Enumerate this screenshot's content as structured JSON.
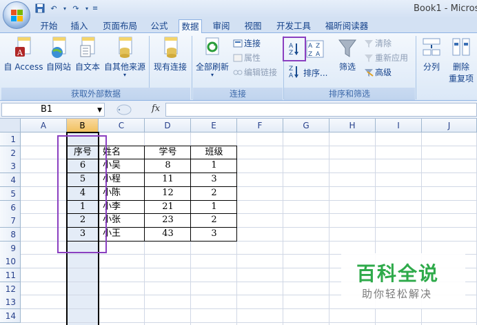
{
  "window": {
    "title": "Book1 - Micros"
  },
  "qat": {
    "save_icon": "save-icon",
    "undo_icon": "undo-icon",
    "redo_icon": "redo-icon",
    "customize_icon": "customize-icon"
  },
  "tabs": [
    {
      "label": "开始"
    },
    {
      "label": "插入"
    },
    {
      "label": "页面布局"
    },
    {
      "label": "公式"
    },
    {
      "label": "数据",
      "active": true
    },
    {
      "label": "审阅"
    },
    {
      "label": "视图"
    },
    {
      "label": "开发工具"
    },
    {
      "label": "福昕阅读器"
    }
  ],
  "ribbon": {
    "external": {
      "group_label": "获取外部数据",
      "buttons": [
        "自 Access",
        "自网站",
        "自文本",
        "自其他来源",
        "现有连接"
      ]
    },
    "connections": {
      "group_label": "连接",
      "refresh_all": "全部刷新",
      "small": [
        "连接",
        "属性",
        "编辑链接"
      ]
    },
    "sort_filter": {
      "group_label": "排序和筛选",
      "sort": "排序...",
      "filter": "筛选",
      "small": [
        "清除",
        "重新应用",
        "高级"
      ]
    },
    "data_tools": {
      "split": "分列",
      "remove_dup_1": "删除",
      "remove_dup_2": "重复项"
    }
  },
  "formula_bar": {
    "name_box": "B1",
    "fx": "fx",
    "formula": ""
  },
  "columns": [
    "A",
    "B",
    "C",
    "D",
    "E",
    "F",
    "G",
    "H",
    "I",
    "J"
  ],
  "rows": [
    "1",
    "2",
    "3",
    "4",
    "5",
    "6",
    "7",
    "8",
    "9",
    "10",
    "11",
    "12",
    "13",
    "14"
  ],
  "table": {
    "headers": [
      "序号",
      "姓名",
      "学号",
      "班级"
    ],
    "rows": [
      [
        "6",
        "小吴",
        "8",
        "1"
      ],
      [
        "5",
        "小程",
        "11",
        "3"
      ],
      [
        "4",
        "小陈",
        "12",
        "2"
      ],
      [
        "1",
        "小李",
        "21",
        "1"
      ],
      [
        "2",
        "小张",
        "23",
        "2"
      ],
      [
        "3",
        "小王",
        "43",
        "3"
      ]
    ]
  },
  "watermark": {
    "title": "百科全说",
    "subtitle": "助你轻松解决"
  },
  "colors": {
    "highlight": "#8a3fc0",
    "selected_header": "#f1c15f",
    "watermark_green": "#2eaa4a"
  }
}
